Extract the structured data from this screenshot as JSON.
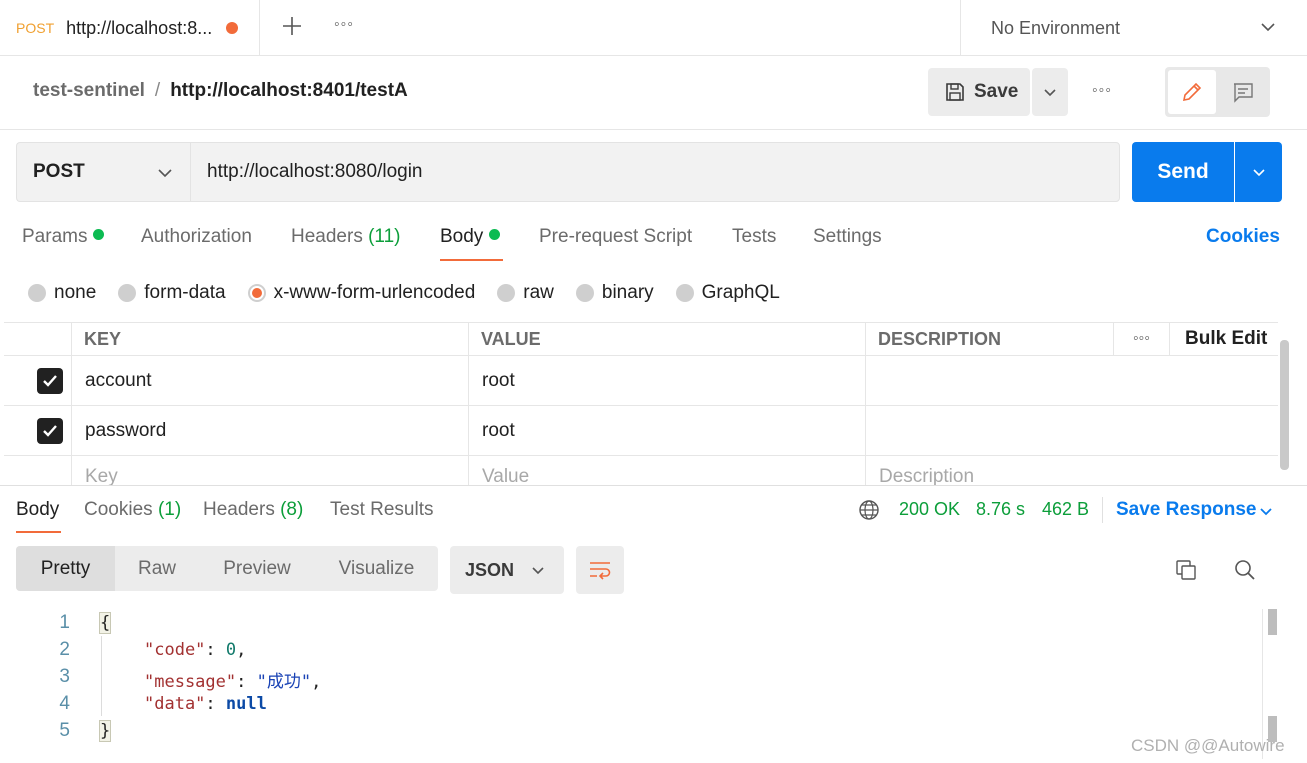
{
  "tab": {
    "method": "POST",
    "url": "http://localhost:8..."
  },
  "environment": {
    "label": "No Environment"
  },
  "breadcrumb": {
    "collection": "test-sentinel",
    "separator": "/",
    "request": "http://localhost:8401/testA"
  },
  "toolbar": {
    "save_label": "Save"
  },
  "request": {
    "method": "POST",
    "url": "http://localhost:8080/login",
    "send_label": "Send"
  },
  "request_tabs": [
    {
      "label": "Params",
      "dot": true
    },
    {
      "label": "Authorization"
    },
    {
      "label": "Headers",
      "count": "(11)"
    },
    {
      "label": "Body",
      "dot": true,
      "active": true
    },
    {
      "label": "Pre-request Script"
    },
    {
      "label": "Tests"
    },
    {
      "label": "Settings"
    }
  ],
  "cookies_link": "Cookies",
  "body_types": [
    "none",
    "form-data",
    "x-www-form-urlencoded",
    "raw",
    "binary",
    "GraphQL"
  ],
  "body_type_selected": "x-www-form-urlencoded",
  "params_table": {
    "headers": {
      "key": "KEY",
      "value": "VALUE",
      "description": "DESCRIPTION",
      "bulk_edit": "Bulk Edit"
    },
    "rows": [
      {
        "key": "account",
        "value": "root",
        "checked": true
      },
      {
        "key": "password",
        "value": "root",
        "checked": true
      }
    ],
    "placeholders": {
      "key": "Key",
      "value": "Value",
      "description": "Description"
    }
  },
  "response_tabs": [
    {
      "label": "Body",
      "active": true
    },
    {
      "label": "Cookies",
      "count": "(1)"
    },
    {
      "label": "Headers",
      "count": "(8)"
    },
    {
      "label": "Test Results"
    }
  ],
  "response_status": {
    "status": "200 OK",
    "time": "8.76 s",
    "size": "462 B"
  },
  "save_response": "Save Response",
  "view_modes": [
    "Pretty",
    "Raw",
    "Preview",
    "Visualize"
  ],
  "format": "JSON",
  "code": {
    "line_numbers": [
      "1",
      "2",
      "3",
      "4",
      "5"
    ],
    "open_brace": "{",
    "close_brace": "}",
    "k_code": "\"code\"",
    "v_code": "0",
    "k_message": "\"message\"",
    "v_message": "\"成功\"",
    "k_data": "\"data\"",
    "v_data": "null"
  },
  "watermark": "CSDN @@Autowire",
  "colors": {
    "accent": "#097bed",
    "active_tab": "#f26b3a",
    "success": "#0c9e3a"
  }
}
